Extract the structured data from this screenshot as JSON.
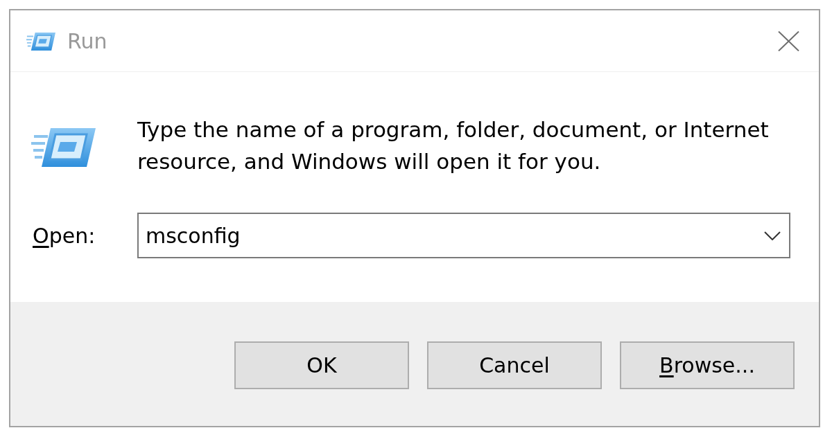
{
  "window": {
    "title": "Run"
  },
  "description": "Type the name of a program, folder, document, or Internet resource, and Windows will open it for you.",
  "open_field": {
    "label": "Open:",
    "access_key_underlined": true,
    "value": "msconfig"
  },
  "buttons": [
    {
      "label": "OK",
      "access_key_underlined": false
    },
    {
      "label": "Cancel",
      "access_key_underlined": false
    },
    {
      "label": "Browse...",
      "access_key_underlined": true
    }
  ]
}
